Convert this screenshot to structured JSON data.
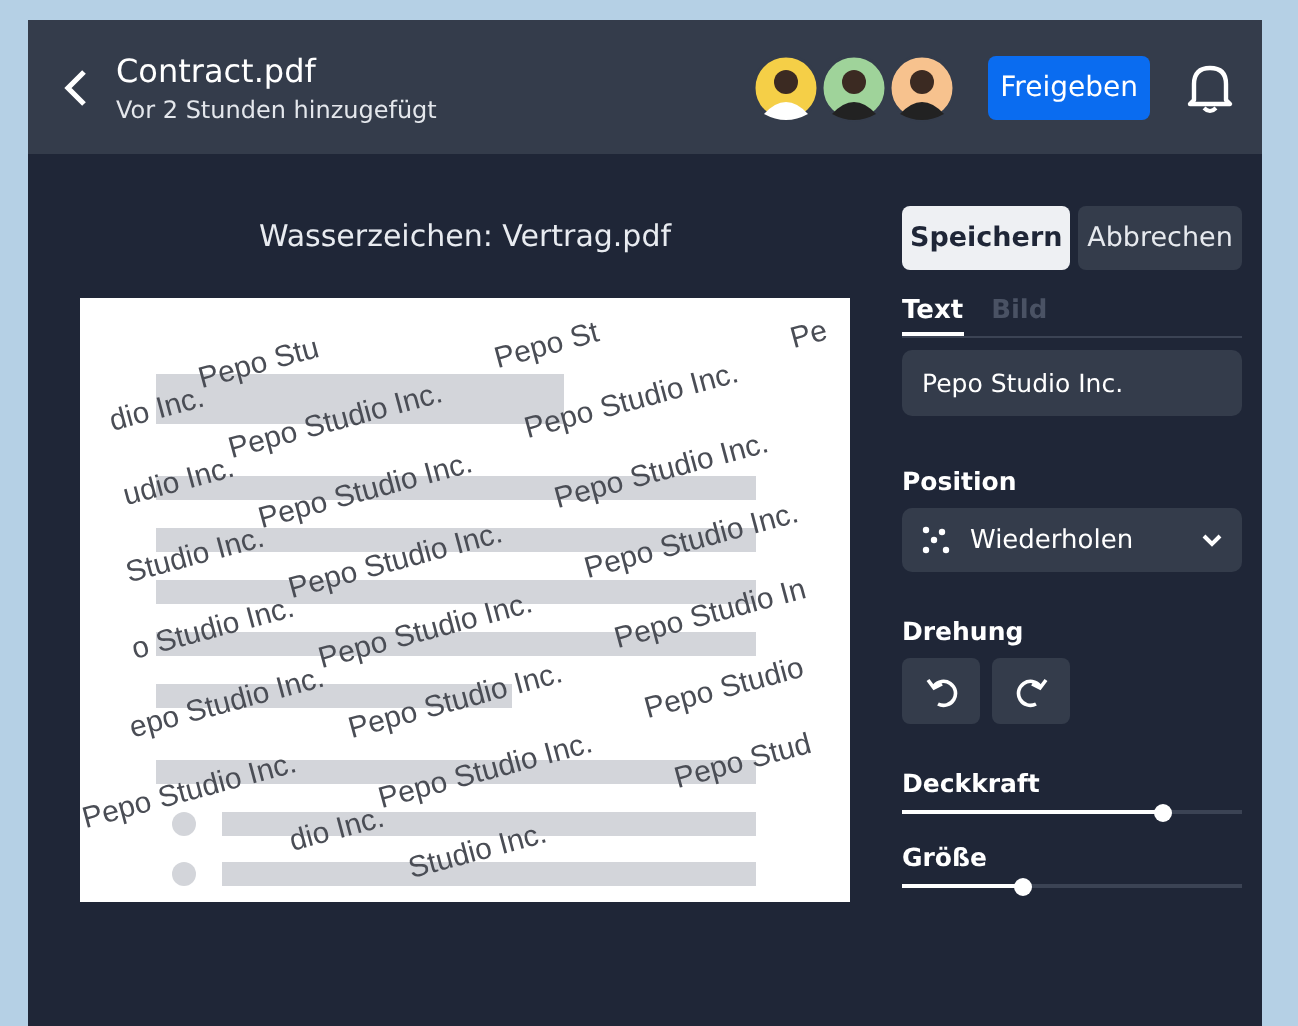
{
  "header": {
    "title": "Contract.pdf",
    "subtitle": "Vor 2 Stunden hinzugefügt",
    "avatars": [
      {
        "color": "#f5cf47"
      },
      {
        "color": "#9fd39a"
      },
      {
        "color": "#f7c28e"
      }
    ],
    "share_button": "Freigeben"
  },
  "preview": {
    "title": "Wasserzeichen: Vertrag.pdf",
    "document_lines": [
      {
        "kind": "heading"
      },
      {
        "kind": "line"
      },
      {
        "kind": "line"
      },
      {
        "kind": "line"
      },
      {
        "kind": "line"
      },
      {
        "kind": "short"
      },
      {
        "kind": "line"
      },
      {
        "kind": "bullet"
      },
      {
        "kind": "bullet"
      }
    ],
    "watermark_rows": [
      [
        "",
        "Pepo Stu",
        "Pepo St",
        "Pe"
      ],
      [
        "dio Inc.",
        "Pepo Studio Inc.",
        "Pepo Studio Inc."
      ],
      [
        "udio Inc.",
        "Pepo Studio Inc.",
        "Pepo Studio Inc."
      ],
      [
        "Studio Inc.",
        "Pepo Studio Inc.",
        "Pepo Studio Inc."
      ],
      [
        "o Studio Inc.",
        "Pepo Studio Inc.",
        "Pepo Studio In"
      ],
      [
        "epo Studio Inc.",
        "Pepo Studio Inc.",
        "Pepo Studio"
      ],
      [
        "Pepo Studio Inc.",
        "Pepo Studio Inc.",
        "Pepo Stud"
      ],
      [
        "dio Inc.",
        "Studio Inc."
      ]
    ]
  },
  "panel": {
    "buttons": [
      {
        "label": "Speichern",
        "kind": "primary"
      },
      {
        "label": "Abbrechen",
        "kind": "secondary"
      }
    ],
    "tabs": [
      {
        "label": "Text",
        "selected": true
      },
      {
        "label": "Bild",
        "selected": false
      }
    ],
    "text_value": "Pepo Studio Inc.",
    "position": {
      "label": "Position",
      "value": "Wiederholen"
    },
    "rotation": {
      "label": "Drehung"
    },
    "sliders": [
      {
        "label": "Deckkraft",
        "level": 0.77
      },
      {
        "label": "Größe",
        "level": 0.355
      }
    ]
  }
}
